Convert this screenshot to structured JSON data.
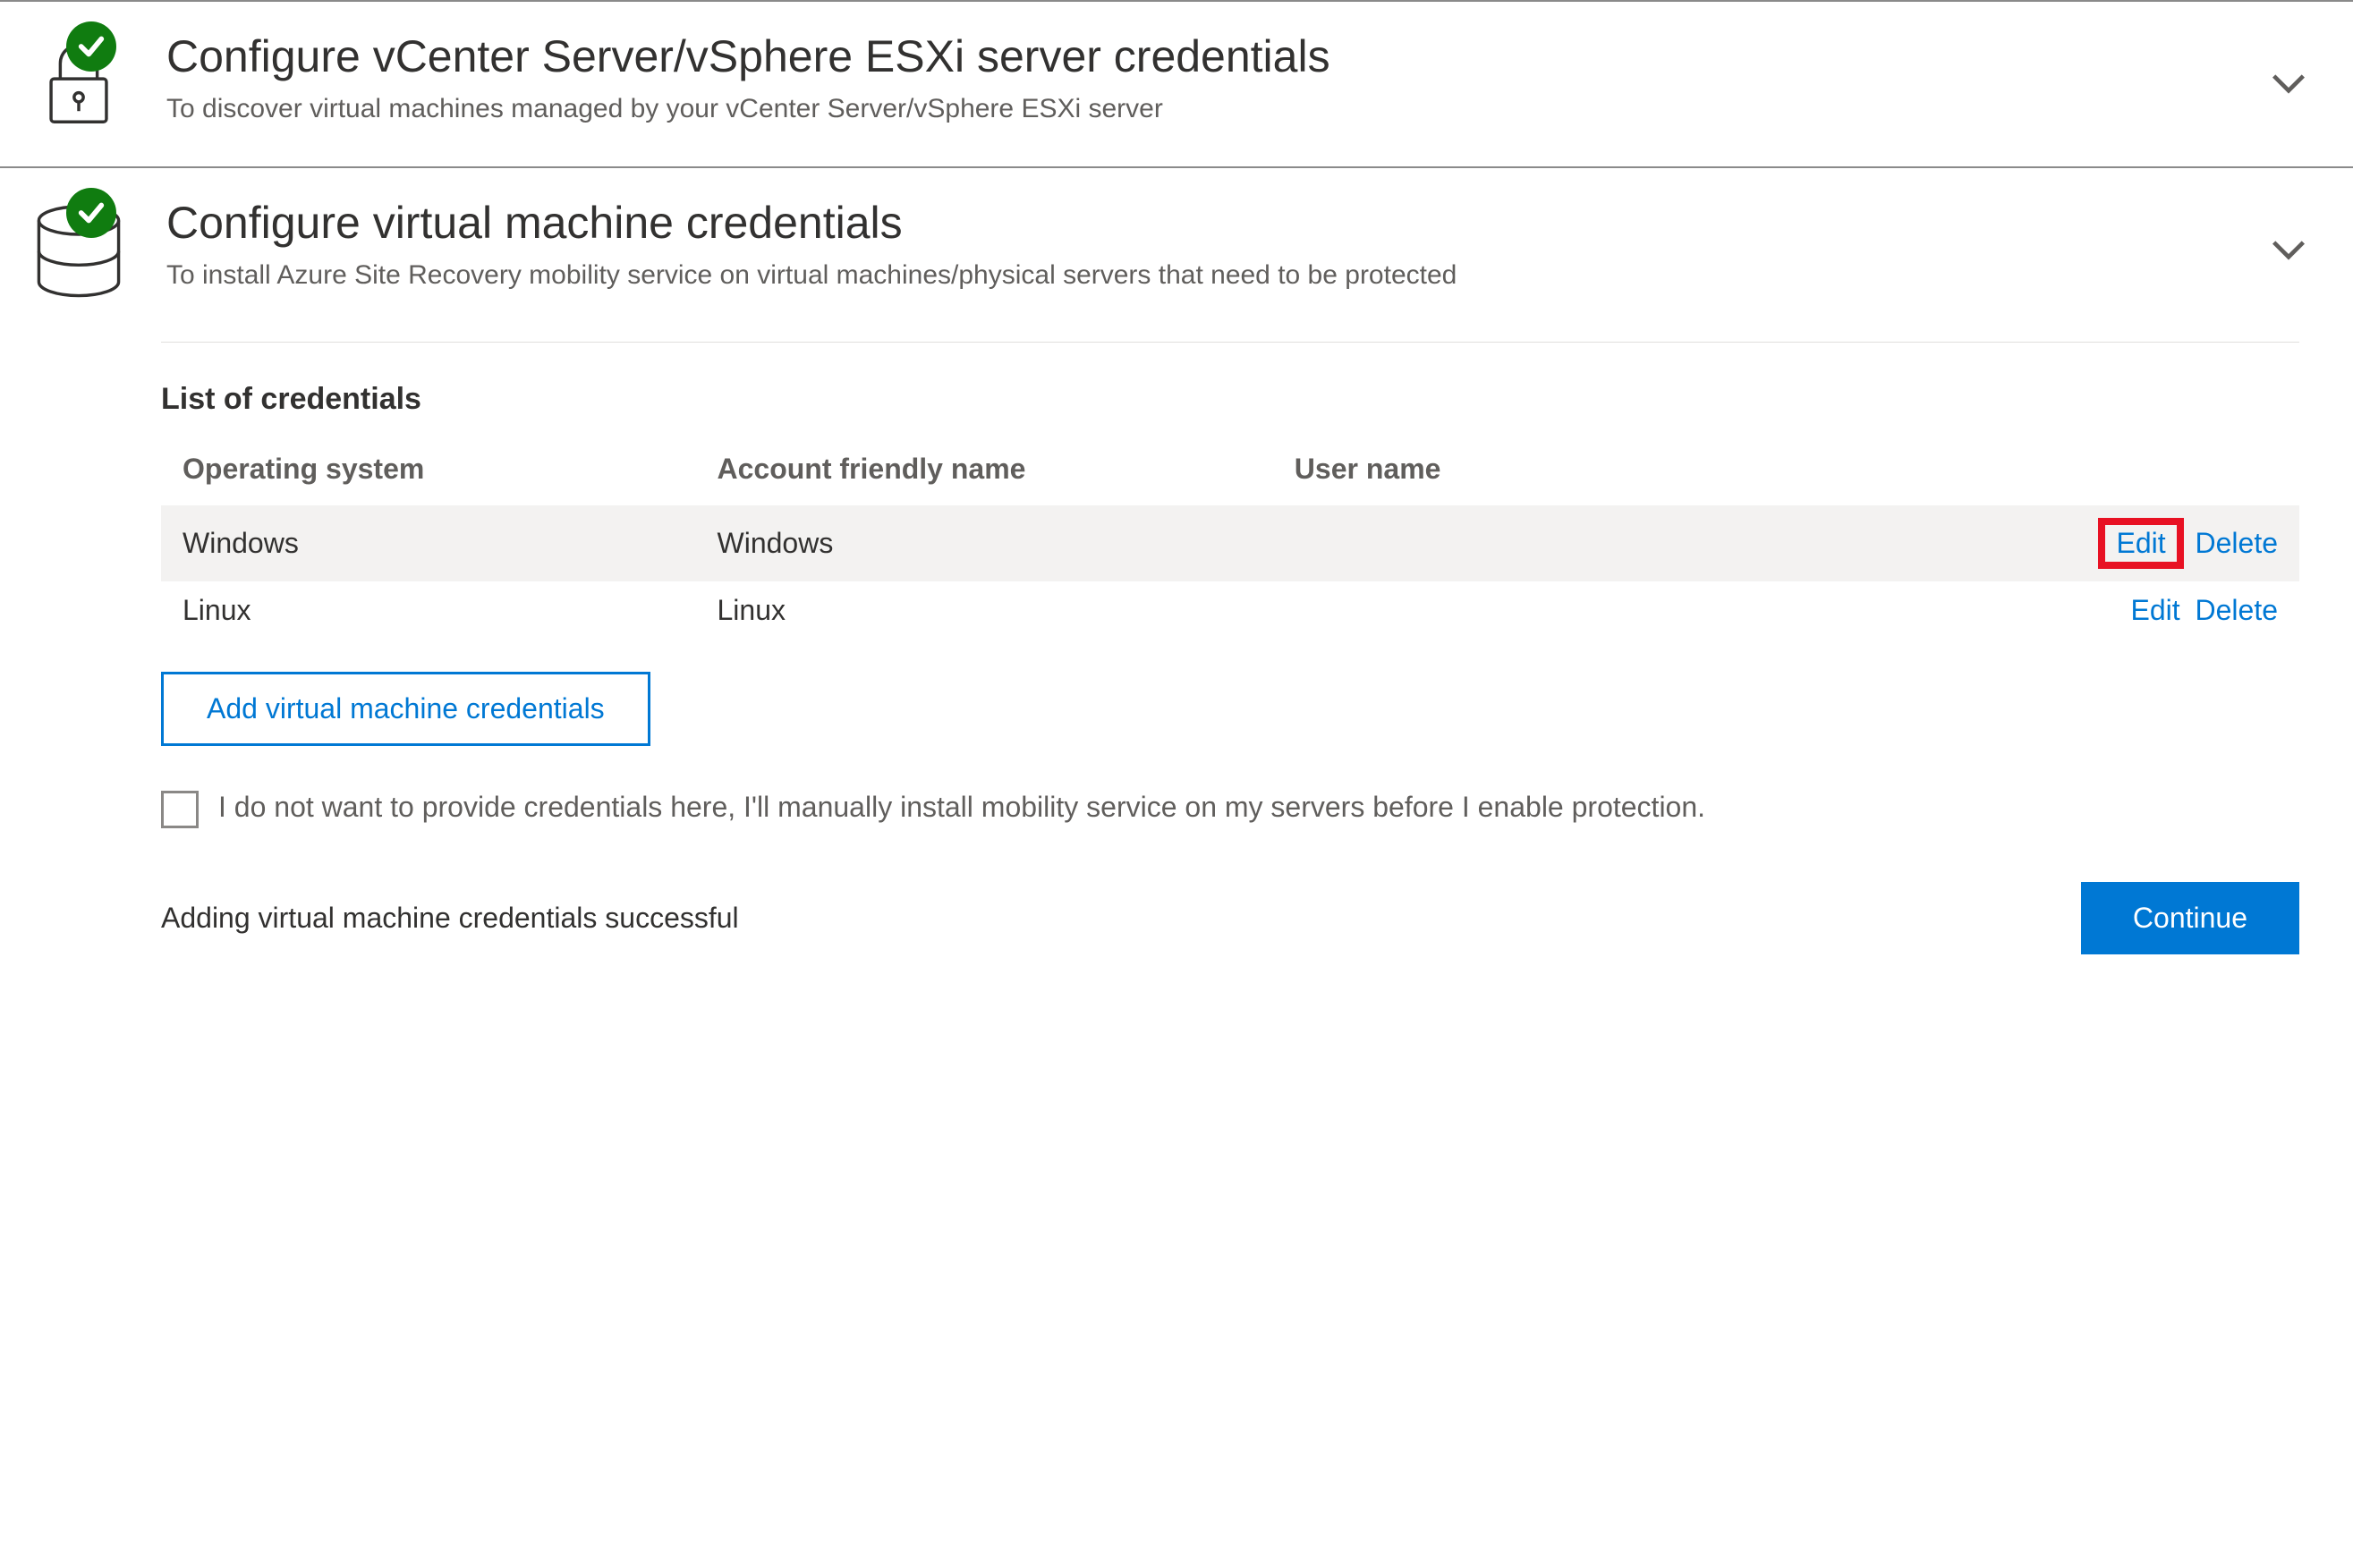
{
  "sections": [
    {
      "title": "Configure vCenter Server/vSphere ESXi server credentials",
      "desc": "To discover virtual machines managed by your vCenter Server/vSphere ESXi server"
    },
    {
      "title": "Configure virtual machine credentials",
      "desc": "To install Azure Site Recovery mobility service on virtual machines/physical servers that need to be protected"
    }
  ],
  "table": {
    "header": "List of credentials",
    "columns": [
      "Operating system",
      "Account friendly name",
      "User name"
    ],
    "rows": [
      {
        "os": "Windows",
        "friendly": "Windows",
        "user": ""
      },
      {
        "os": "Linux",
        "friendly": "Linux",
        "user": ""
      }
    ],
    "actions": {
      "edit": "Edit",
      "delete": "Delete"
    }
  },
  "buttons": {
    "add": "Add virtual machine credentials",
    "continue": "Continue"
  },
  "optOut": "I do not want to provide credentials here, I'll manually install mobility service on my servers before I enable protection.",
  "status": "Adding virtual machine credentials successful"
}
